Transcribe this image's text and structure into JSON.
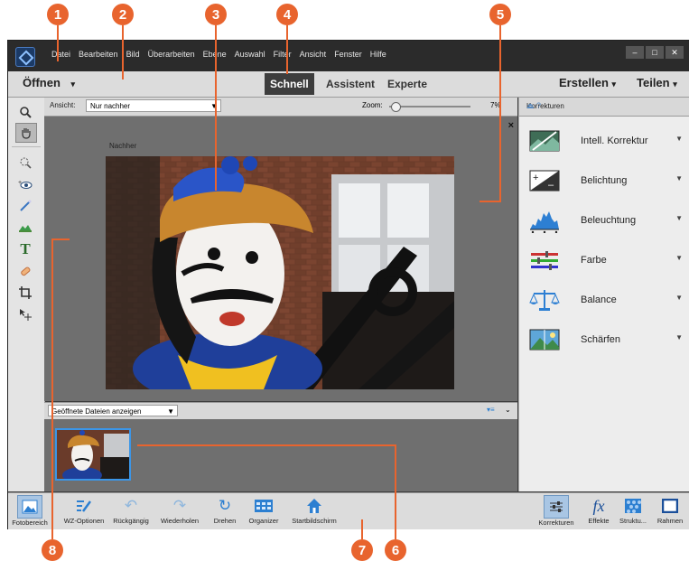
{
  "menu": [
    "Datei",
    "Bearbeiten",
    "Bild",
    "Überarbeiten",
    "Ebene",
    "Auswahl",
    "Filter",
    "Ansicht",
    "Fenster",
    "Hilfe"
  ],
  "window_buttons": [
    "–",
    "□",
    "✕"
  ],
  "modebar": {
    "open_label": "Öffnen",
    "tabs": [
      "Schnell",
      "Assistent",
      "Experte"
    ],
    "active_tab": "Schnell",
    "create_label": "Erstellen",
    "share_label": "Teilen"
  },
  "viewbar": {
    "view_label": "Ansicht:",
    "view_value": "Nur nachher",
    "zoom_label": "Zoom:",
    "zoom_value": "7%",
    "zoom_fraction": 0.07
  },
  "canvas": {
    "label": "Nachher",
    "close": "×"
  },
  "bin": {
    "select_value": "Geöffnete Dateien anzeigen"
  },
  "panel": {
    "title": "Korrekturen",
    "items": [
      {
        "label": "Intell. Korrektur",
        "icon": "smart-fix-icon"
      },
      {
        "label": "Belichtung",
        "icon": "exposure-icon"
      },
      {
        "label": "Beleuchtung",
        "icon": "lighting-histogram-icon"
      },
      {
        "label": "Farbe",
        "icon": "color-sliders-icon"
      },
      {
        "label": "Balance",
        "icon": "balance-scale-icon"
      },
      {
        "label": "Schärfen",
        "icon": "sharpen-icon"
      }
    ]
  },
  "taskbar": {
    "left": [
      {
        "label": "Fotobereich",
        "icon": "photo-bin-icon"
      },
      {
        "label": "WZ-Optionen",
        "icon": "tool-options-icon"
      },
      {
        "label": "Rückgängig",
        "icon": "undo-icon"
      },
      {
        "label": "Wiederholen",
        "icon": "redo-icon"
      },
      {
        "label": "Drehen",
        "icon": "rotate-icon"
      },
      {
        "label": "Organizer",
        "icon": "organizer-icon"
      },
      {
        "label": "Startbildschirm",
        "icon": "home-icon"
      }
    ],
    "right": [
      {
        "label": "Korrekturen",
        "icon": "adjustments-icon"
      },
      {
        "label": "Effekte",
        "icon": "fx-icon"
      },
      {
        "label": "Struktu...",
        "icon": "textures-icon"
      },
      {
        "label": "Rahmen",
        "icon": "frames-icon"
      }
    ]
  },
  "callouts": [
    "1",
    "2",
    "3",
    "4",
    "5",
    "6",
    "7",
    "8"
  ],
  "colors": {
    "callout": "#e8642e",
    "accent": "#2c7fd1",
    "selection": "#3b96e8"
  }
}
